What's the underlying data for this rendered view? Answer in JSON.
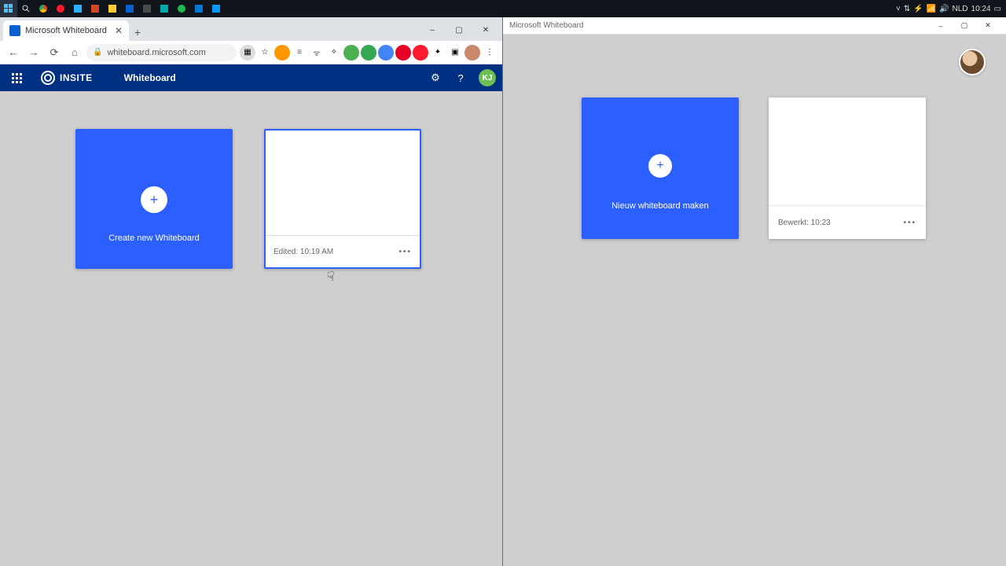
{
  "taskbar": {
    "icons": [
      "start",
      "search",
      "chrome",
      "opera",
      "trello",
      "powerpoint",
      "files",
      "outlook",
      "hydra",
      "sigma",
      "spotify",
      "store",
      "store2"
    ],
    "tray": {
      "lang": "NLD",
      "time": "10:24"
    }
  },
  "chrome": {
    "tab_title": "Microsoft Whiteboard",
    "url": "whiteboard.microsoft.com",
    "window_controls": {
      "min": "–",
      "max": "▢",
      "close": "✕"
    }
  },
  "wbweb": {
    "brand": "INSITE",
    "title": "Whiteboard",
    "avatar_initials": "KJ",
    "create_label": "Create new Whiteboard",
    "existing_footer": "Edited: 10:19 AM"
  },
  "native": {
    "title": "Microsoft Whiteboard",
    "create_label": "Nieuw whiteboard maken",
    "existing_footer": "Bewerkt: 10:23"
  },
  "colors": {
    "brand_blue": "#003082",
    "tile_blue": "#2b5fff",
    "canvas_grey": "#cfcfcf"
  }
}
